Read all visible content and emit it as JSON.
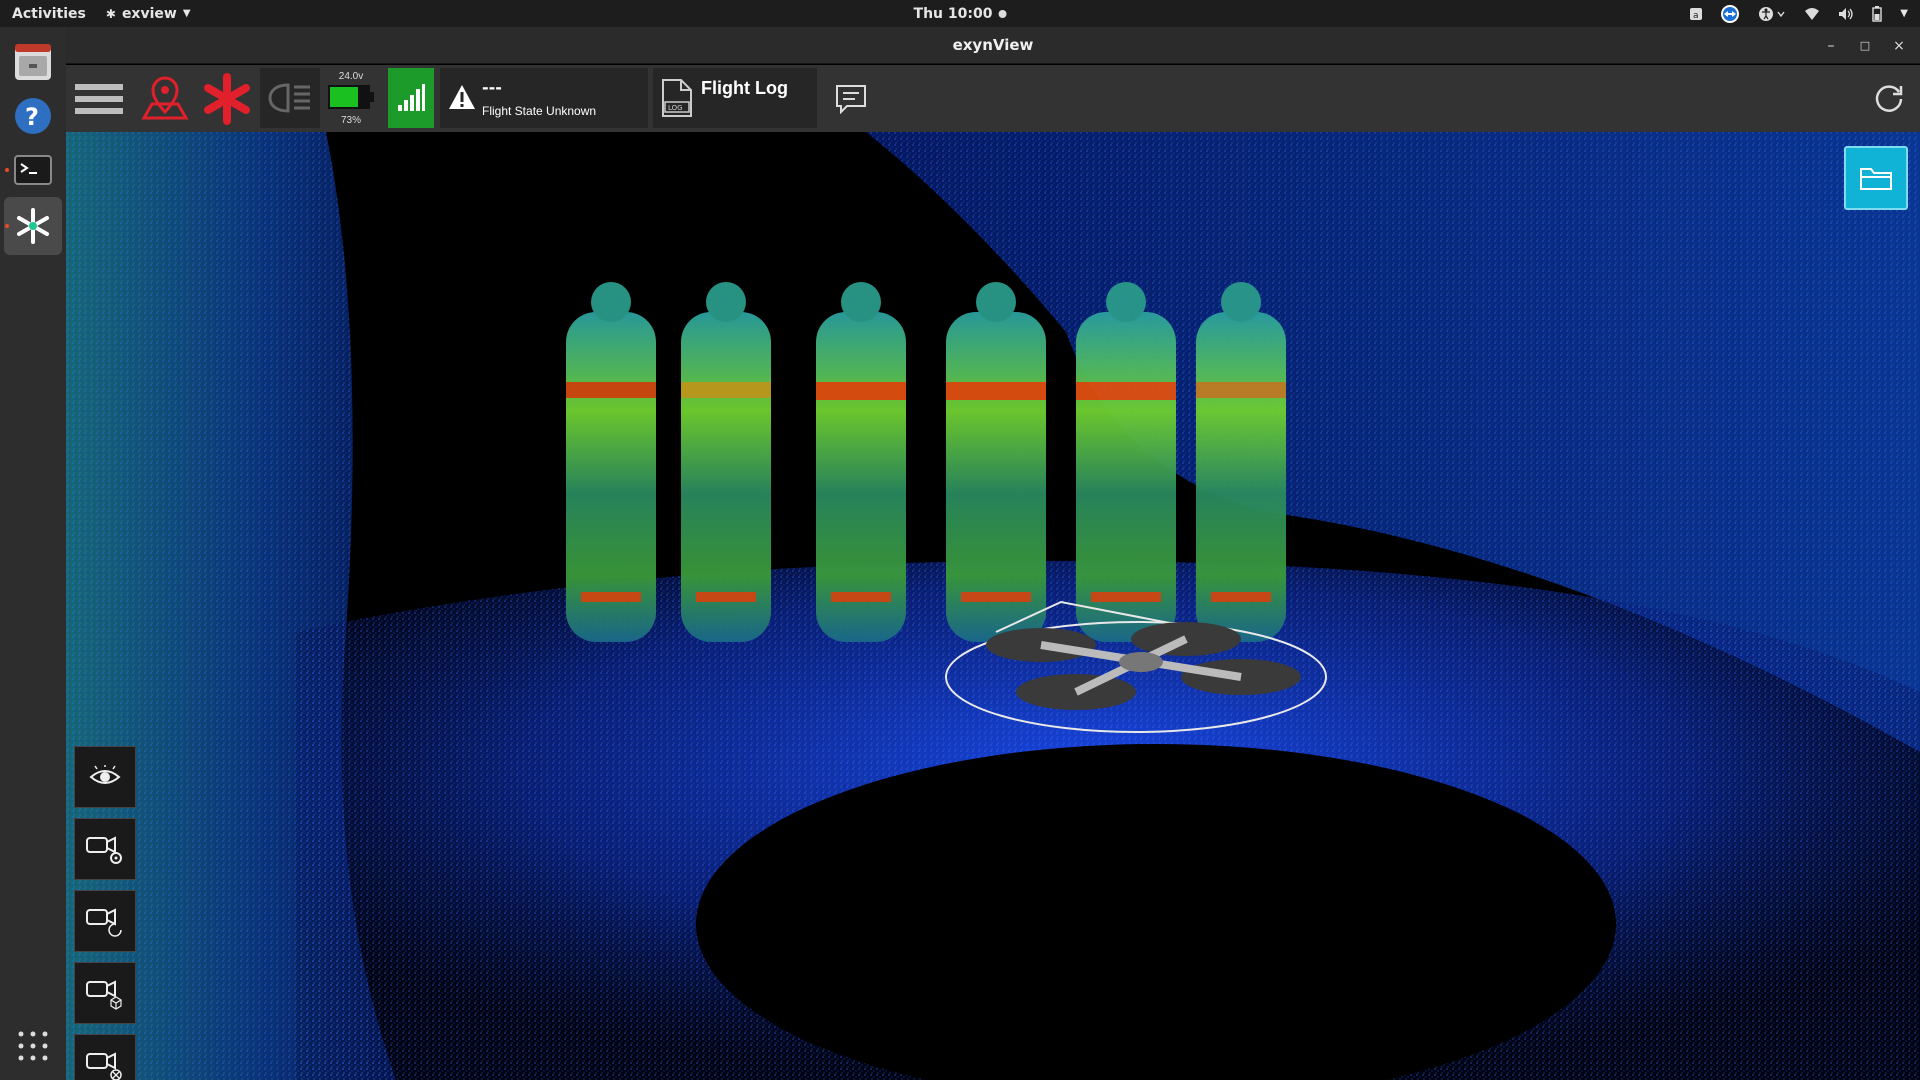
{
  "topbar": {
    "activities": "Activities",
    "app_name": "exview",
    "clock": "Thu 10:00"
  },
  "window": {
    "title": "exynView"
  },
  "toolbar": {
    "battery_voltage": "24.0v",
    "battery_percent": "73%",
    "battery_level": 0.73,
    "flight_state_value": "---",
    "flight_state_label": "Flight State Unknown",
    "flight_log_label": "Flight Log"
  },
  "colors": {
    "accent_red": "#e0202a",
    "battery_green": "#19c01f",
    "signal_green": "#1c9b2a",
    "folder_cyan": "#10b3d6"
  },
  "icons": {
    "menu": "hamburger-icon",
    "map_pin": "map-pin-icon",
    "exyn_logo": "exyn-logo-icon",
    "headlight": "headlight-icon",
    "signal": "signal-bars-icon",
    "warning": "warning-icon",
    "log_file": "log-file-icon",
    "chat": "chat-icon",
    "refresh": "refresh-icon",
    "folder": "folder-icon"
  }
}
